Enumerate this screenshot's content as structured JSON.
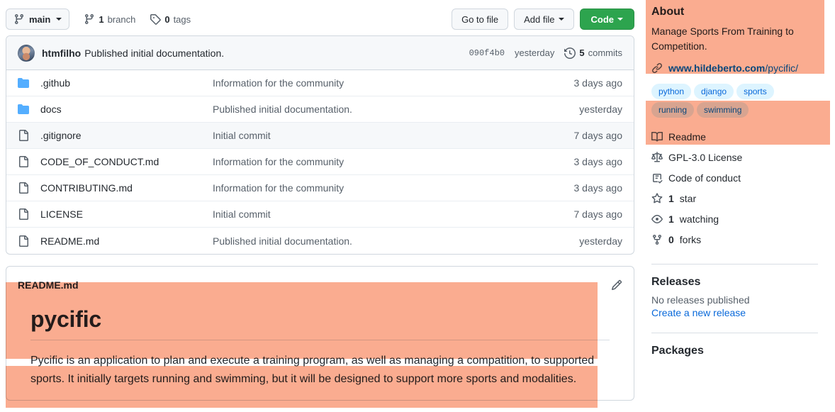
{
  "toolbar": {
    "branch": "main",
    "branches_count": "1",
    "branches_label": "branch",
    "tags_count": "0",
    "tags_label": "tags",
    "go_to_file": "Go to file",
    "add_file": "Add file",
    "code": "Code"
  },
  "commit_bar": {
    "author": "htmfilho",
    "message": "Published initial documentation.",
    "sha": "090f4b0",
    "time": "yesterday",
    "commits_count": "5",
    "commits_label": "commits"
  },
  "files": [
    {
      "icon": "folder-icon",
      "name": ".github",
      "message": "Information for the community",
      "time": "3 days ago",
      "hover": false
    },
    {
      "icon": "folder-icon",
      "name": "docs",
      "message": "Published initial documentation.",
      "time": "yesterday",
      "hover": false
    },
    {
      "icon": "file-icon",
      "name": ".gitignore",
      "message": "Initial commit",
      "time": "7 days ago",
      "hover": true
    },
    {
      "icon": "file-icon",
      "name": "CODE_OF_CONDUCT.md",
      "message": "Information for the community",
      "time": "3 days ago",
      "hover": false
    },
    {
      "icon": "file-icon",
      "name": "CONTRIBUTING.md",
      "message": "Information for the community",
      "time": "3 days ago",
      "hover": false
    },
    {
      "icon": "file-icon",
      "name": "LICENSE",
      "message": "Initial commit",
      "time": "7 days ago",
      "hover": false
    },
    {
      "icon": "file-icon",
      "name": "README.md",
      "message": "Published initial documentation.",
      "time": "yesterday",
      "hover": false
    }
  ],
  "readme": {
    "filename": "README.md",
    "heading": "pycific",
    "paragraph": "Pycific is an application to plan and execute a training program, as well as managing a compatition, to supported sports. It initially targets running and swimming, but it will be designed to support more sports and modalities."
  },
  "about": {
    "title": "About",
    "description": "Manage Sports From Training to Competition.",
    "homepage_main": "www.hildeberto.com",
    "homepage_path": "/pycific/",
    "topics": [
      "python",
      "django",
      "sports",
      "running",
      "swimming"
    ],
    "items": [
      {
        "icon": "book-icon",
        "count": "",
        "label": "Readme"
      },
      {
        "icon": "law-icon",
        "count": "",
        "label": "GPL-3.0 License"
      },
      {
        "icon": "checklist-icon",
        "count": "",
        "label": "Code of conduct"
      },
      {
        "icon": "star-icon",
        "count": "1",
        "label": "star"
      },
      {
        "icon": "eye-icon",
        "count": "1",
        "label": "watching"
      },
      {
        "icon": "fork-icon",
        "count": "0",
        "label": "forks"
      }
    ]
  },
  "releases": {
    "title": "Releases",
    "empty_text": "No releases published",
    "create_link": "Create a new release"
  },
  "packages": {
    "title": "Packages"
  },
  "colors": {
    "selection_highlight": "#faac90",
    "primary_button": "#2da44e",
    "link": "#0969da",
    "folder_icon": "#54aeff",
    "muted_text": "#57606a"
  }
}
